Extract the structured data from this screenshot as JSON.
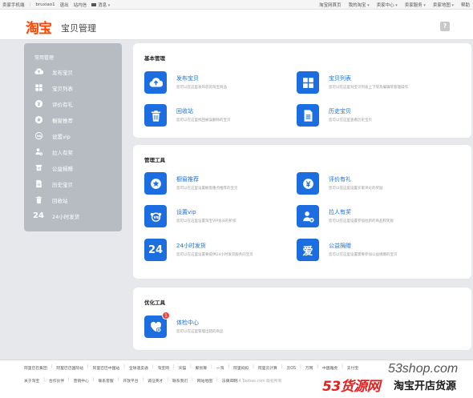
{
  "topbar": {
    "left": [
      "卖家手机端",
      "bruxiao1",
      "退出",
      "站内信",
      "消息"
    ],
    "right": [
      "淘宝网首页",
      "我的淘宝",
      "卖家中心",
      "卖家服务",
      "卖家地图",
      "帮助"
    ]
  },
  "header": {
    "logo": "淘宝",
    "title": "宝贝管理",
    "help": "?"
  },
  "sidebar": {
    "title": "常用管理",
    "items": [
      {
        "label": "发布宝贝",
        "icon": "upload-icon"
      },
      {
        "label": "宝贝列表",
        "icon": "grid-icon"
      },
      {
        "label": "评价有礼",
        "icon": "yen-icon"
      },
      {
        "label": "橱窗推荐",
        "icon": "star-icon"
      },
      {
        "label": "设置vip",
        "icon": "vip-icon"
      },
      {
        "label": "拉人有奖",
        "icon": "user-add-icon"
      },
      {
        "label": "公益捐赠",
        "icon": "donate-icon"
      },
      {
        "label": "历史宝贝",
        "icon": "document-icon"
      },
      {
        "label": "回收站",
        "icon": "trash-icon"
      },
      {
        "label": "24小时发货",
        "icon": "24-icon",
        "text": "24"
      }
    ]
  },
  "sections": [
    {
      "title": "基本管理",
      "cards": [
        {
          "name": "发布宝贝",
          "desc": "您可以在这里发布您的淘宝商品"
        },
        {
          "name": "宝贝列表",
          "desc": "您可以在这里对宝贝列表上下架及编辑等管理操作"
        },
        {
          "name": "回收站",
          "desc": "您可以在这里找回被误删除的宝贝"
        },
        {
          "name": "历史宝贝",
          "desc": "您可以在这里查看历史宝贝"
        }
      ]
    },
    {
      "title": "管理工具",
      "cards": [
        {
          "name": "橱窗推荐",
          "desc": "您可以在这里设置橱窗重点推荐的宝贝"
        },
        {
          "name": "评价有礼",
          "desc": "您可以在这里设置买家评论的奖励"
        },
        {
          "name": "设置vip",
          "desc": "您可以在这里设置淘宝VIP会员的折扣"
        },
        {
          "name": "拉人有奖",
          "desc": "您可以在这里设置参加拉新的商品和奖励"
        },
        {
          "name": "24小时发货",
          "desc": "您可以在这里设置要提供24小时发货服务的宝贝",
          "icon_text": "24"
        },
        {
          "name": "公益捐赠",
          "desc": "您可以在这里设置需要参加公益捐赠的宝贝",
          "icon_text": "爱"
        }
      ]
    },
    {
      "title": "优化工具",
      "cards": [
        {
          "name": "体检中心",
          "desc": "您可以在这里管理出错的商品",
          "badge": "1"
        }
      ]
    }
  ],
  "footer": {
    "row1": [
      "阿里巴巴集团",
      "阿里巴巴国际站",
      "阿里巴巴中国站",
      "全球速卖通",
      "淘宝网",
      "天猫",
      "聚划算",
      "一淘",
      "阿里妈妈",
      "阿里云计算",
      "云OS",
      "万网",
      "中国雅虎",
      "支付宝"
    ],
    "row2": [
      "关于淘宝",
      "合作伙伴",
      "营销中心",
      "联系客服",
      "开放平台",
      "诚征英才",
      "联系我们",
      "网站地图",
      "法律声明"
    ],
    "copyright": "© 2014 Taobao.com 版权所有"
  },
  "watermark": {
    "url": "53shop.com",
    "big": "53货源网",
    "small": "淘宝开店货源"
  },
  "colors": {
    "accent": "#1c6ee0",
    "brand": "#ff4400",
    "sidebar": "#b7bcc3"
  }
}
